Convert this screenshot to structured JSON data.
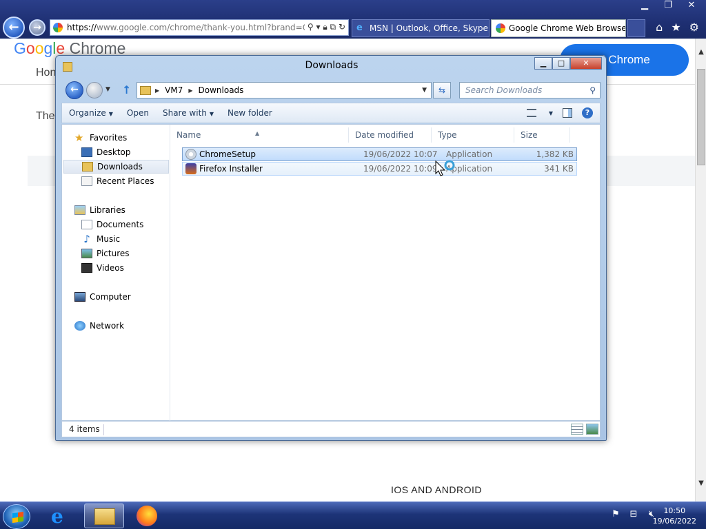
{
  "ie": {
    "url_scheme": "https://",
    "url_domain": "www.google.com",
    "url_rest": "/chrome/thank-you.html?brand=OI",
    "tabs": [
      {
        "label": "MSN | Outlook, Office, Skype, ...",
        "icon": "ie-icon"
      },
      {
        "label": "Google Chrome Web Browser",
        "icon": "google-icon"
      }
    ]
  },
  "webpage": {
    "logo_parts": {
      "g1": "G",
      "o1": "o",
      "o2": "o",
      "g2": "g",
      "l": "l",
      "e": "e",
      "chrome": " Chrome"
    },
    "home_link": "Hon",
    "body_text_partial": "The",
    "download_button": "nload Chrome",
    "ios_android": "IOS AND ANDROID"
  },
  "explorer": {
    "title": "Downloads",
    "breadcrumb": [
      "VM7",
      "Downloads"
    ],
    "search_placeholder": "Search Downloads",
    "toolbar": {
      "organize": "Organize",
      "open": "Open",
      "share_with": "Share with",
      "new_folder": "New folder"
    },
    "nav": {
      "favorites": "Favorites",
      "desktop": "Desktop",
      "downloads": "Downloads",
      "recent_places": "Recent Places",
      "libraries": "Libraries",
      "documents": "Documents",
      "music": "Music",
      "pictures": "Pictures",
      "videos": "Videos",
      "computer": "Computer",
      "network": "Network"
    },
    "columns": {
      "name": "Name",
      "date": "Date modified",
      "type": "Type",
      "size": "Size"
    },
    "files": [
      {
        "name": "ChromeSetup",
        "date": "19/06/2022 10:07",
        "type": "Application",
        "size": "1,382 KB"
      },
      {
        "name": "Firefox Installer",
        "date": "19/06/2022 10:09",
        "type": "Application",
        "size": "341 KB"
      }
    ],
    "status": "4 items"
  },
  "taskbar": {
    "time": "10:50",
    "date": "19/06/2022"
  }
}
